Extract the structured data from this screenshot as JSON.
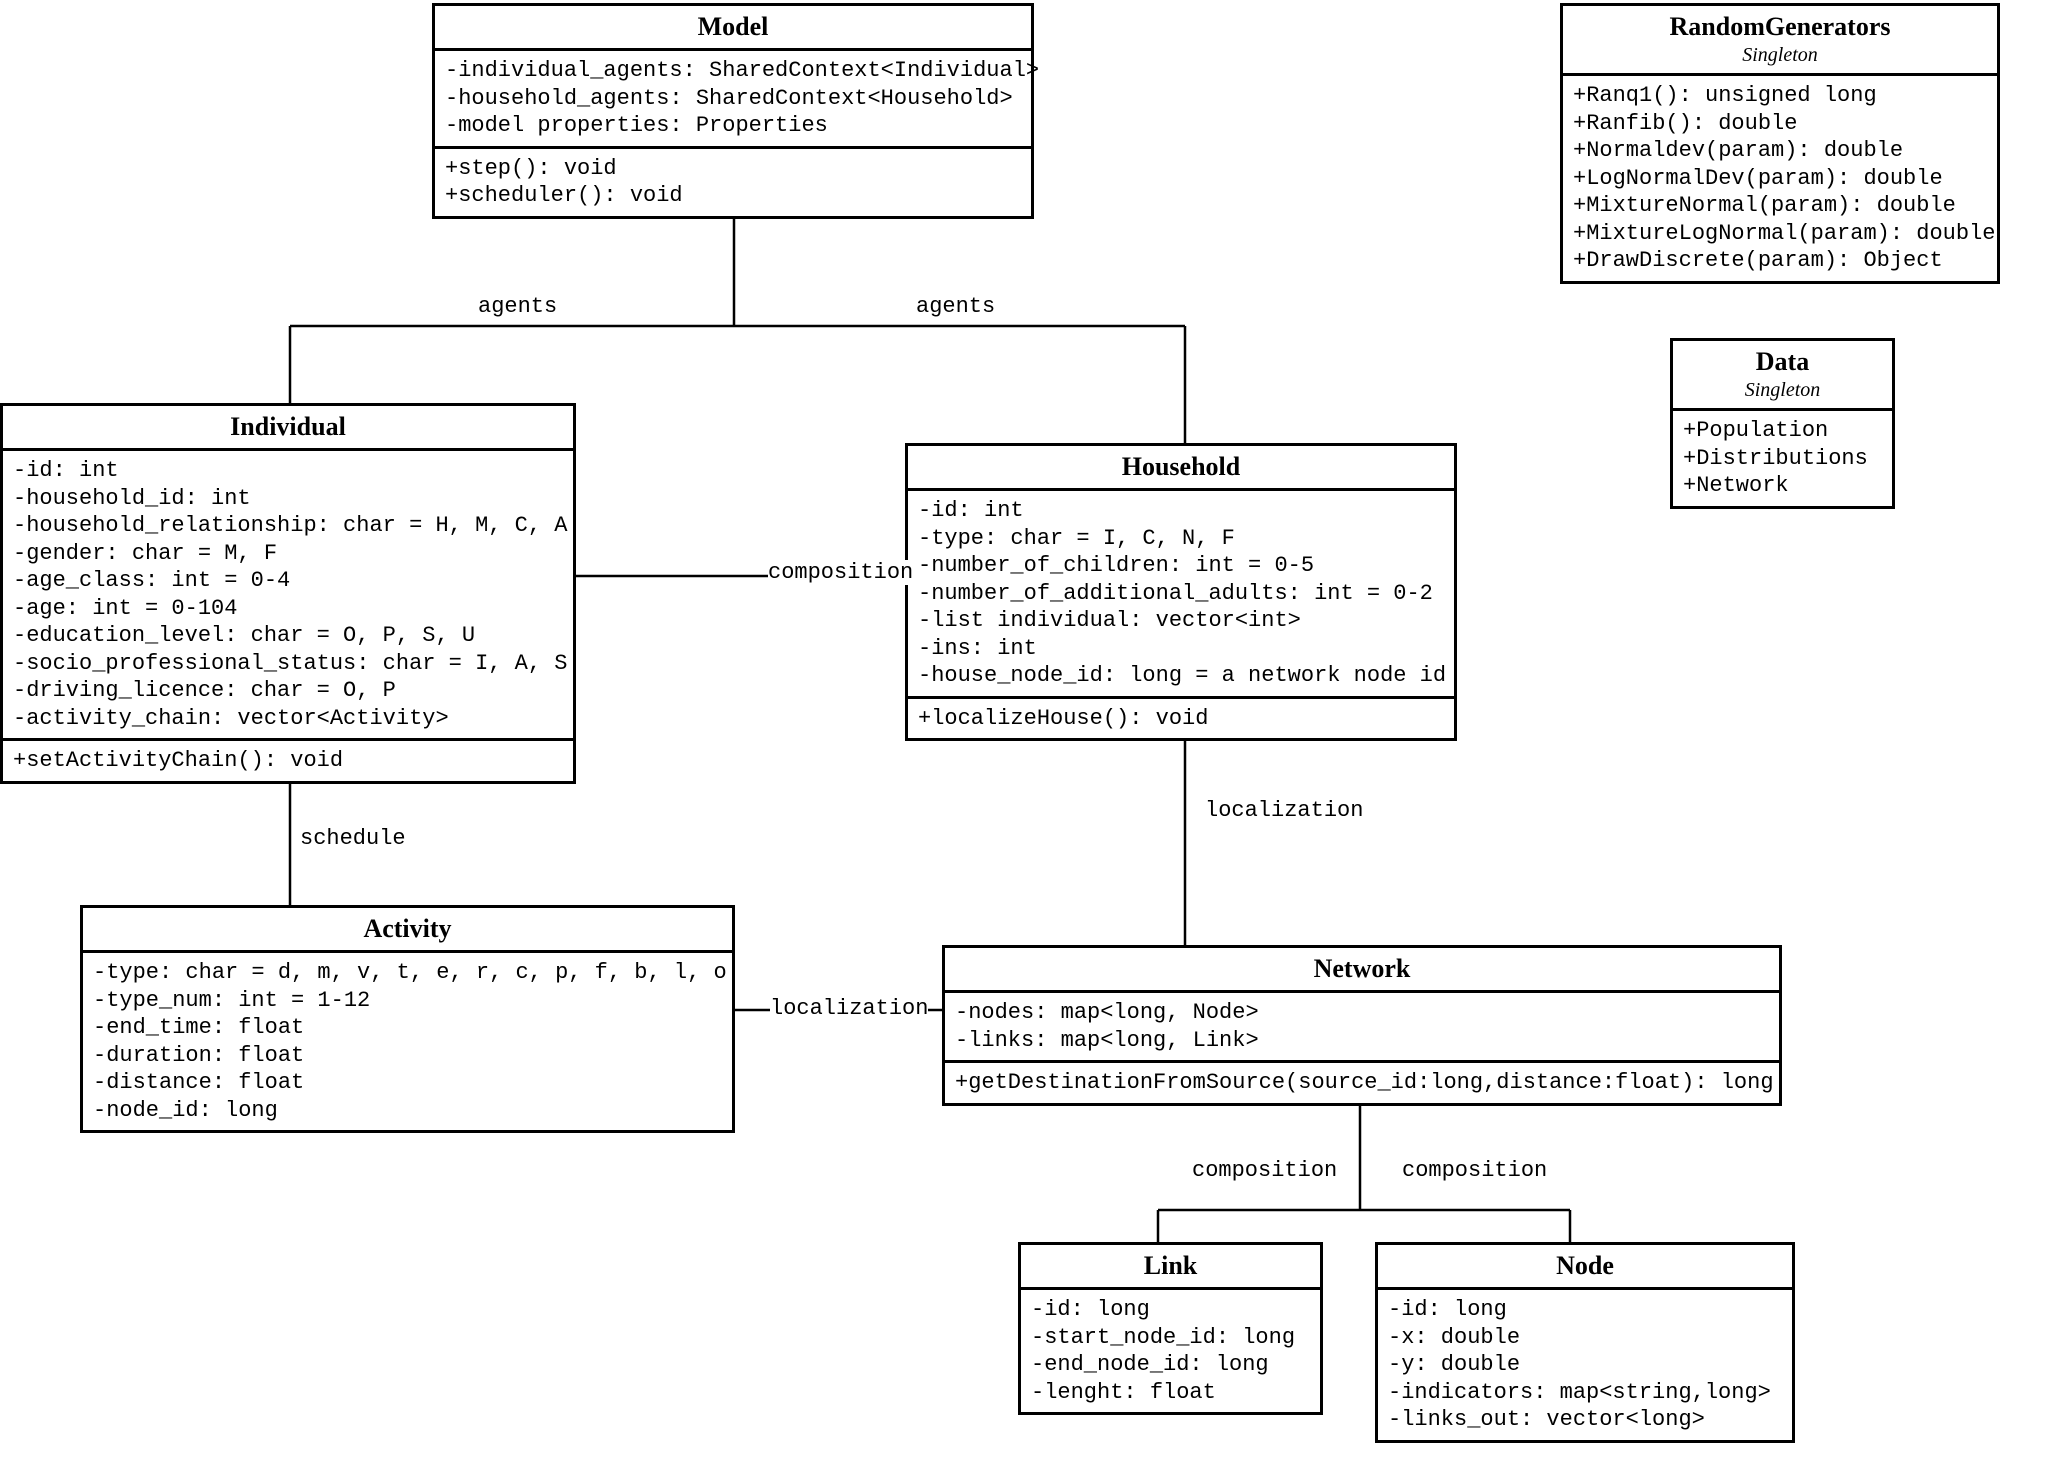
{
  "classes": {
    "model": {
      "title": "Model",
      "attrs": [
        "-individual_agents: SharedContext<Individual>",
        "-household_agents: SharedContext<Household>",
        "-model properties: Properties"
      ],
      "ops": [
        "+step(): void",
        "+scheduler(): void"
      ]
    },
    "randomGenerators": {
      "title": "RandomGenerators",
      "stereo": "Singleton",
      "ops": [
        "+Ranq1(): unsigned long",
        "+Ranfib(): double",
        "+Normaldev(param): double",
        "+LogNormalDev(param): double",
        "+MixtureNormal(param): double",
        "+MixtureLogNormal(param): double",
        "+DrawDiscrete(param): Object"
      ]
    },
    "data": {
      "title": "Data",
      "stereo": "Singleton",
      "attrs": [
        "+Population",
        "+Distributions",
        "+Network"
      ]
    },
    "individual": {
      "title": "Individual",
      "attrs": [
        "-id: int",
        "-household_id: int",
        "-household_relationship: char = H, M, C, A",
        "-gender: char = M, F",
        "-age_class: int = 0-4",
        "-age: int = 0-104",
        "-education_level: char = O, P, S, U",
        "-socio_professional_status: char = I, A, S",
        "-driving_licence: char = O, P",
        "-activity_chain: vector<Activity>"
      ],
      "ops": [
        "+setActivityChain(): void"
      ]
    },
    "household": {
      "title": "Household",
      "attrs": [
        "-id: int",
        "-type: char = I, C, N, F",
        "-number_of_children: int = 0-5",
        "-number_of_additional_adults: int = 0-2",
        "-list individual: vector<int>",
        "-ins: int",
        "-house_node_id: long = a network node id"
      ],
      "ops": [
        "+localizeHouse(): void"
      ]
    },
    "activity": {
      "title": "Activity",
      "attrs": [
        "-type: char = d, m, v, t, e, r, c, p, f, b, l, o",
        "-type_num: int = 1-12",
        "-end_time: float",
        "-duration: float",
        "-distance: float",
        "-node_id: long"
      ]
    },
    "network": {
      "title": "Network",
      "attrs": [
        "-nodes: map<long, Node>",
        "-links: map<long, Link>"
      ],
      "ops": [
        "+getDestinationFromSource(source_id:long,distance:float): long"
      ]
    },
    "link": {
      "title": "Link",
      "attrs": [
        "-id: long",
        "-start_node_id: long",
        "-end_node_id: long",
        "-lenght: float"
      ]
    },
    "node": {
      "title": "Node",
      "attrs": [
        "-id: long",
        "-x: double",
        "-y: double",
        "-indicators: map<string,long>",
        "-links_out: vector<long>"
      ]
    }
  },
  "labels": {
    "agents1": "agents",
    "agents2": "agents",
    "composition1": "composition",
    "schedule": "schedule",
    "localization1": "localization",
    "localization2": "localization",
    "composition2": "composition",
    "composition3": "composition"
  }
}
